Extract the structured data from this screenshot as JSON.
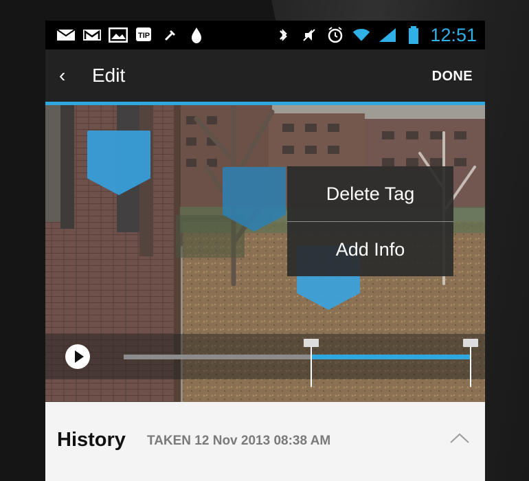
{
  "status_bar": {
    "time": "12:51",
    "left_icons": [
      "email-icon",
      "gmail-icon",
      "image-icon",
      "tip-icon",
      "tool-icon",
      "drop-icon"
    ],
    "right_icons": [
      "bluetooth-icon",
      "mute-icon",
      "alarm-icon",
      "wifi-icon",
      "signal-icon",
      "battery-icon"
    ]
  },
  "app_bar": {
    "back_icon": "chevron-left-icon",
    "back_glyph": "‹",
    "title": "Edit",
    "done_label": "DONE"
  },
  "photo": {
    "popup": {
      "delete_tag_label": "Delete Tag",
      "add_info_label": "Add Info"
    },
    "tags": [
      {
        "name": "tag-marker"
      },
      {
        "name": "tag-marker"
      },
      {
        "name": "tag-marker"
      }
    ],
    "video": {
      "play_icon": "play-icon",
      "selection_start": 0.54,
      "selection_end": 1.0
    }
  },
  "history": {
    "title": "History",
    "meta": "TAKEN 12 Nov 2013 08:38 AM",
    "expand_icon": "chevron-up-icon"
  },
  "colors": {
    "accent": "#2fa7df",
    "clock": "#2fb1e8"
  }
}
